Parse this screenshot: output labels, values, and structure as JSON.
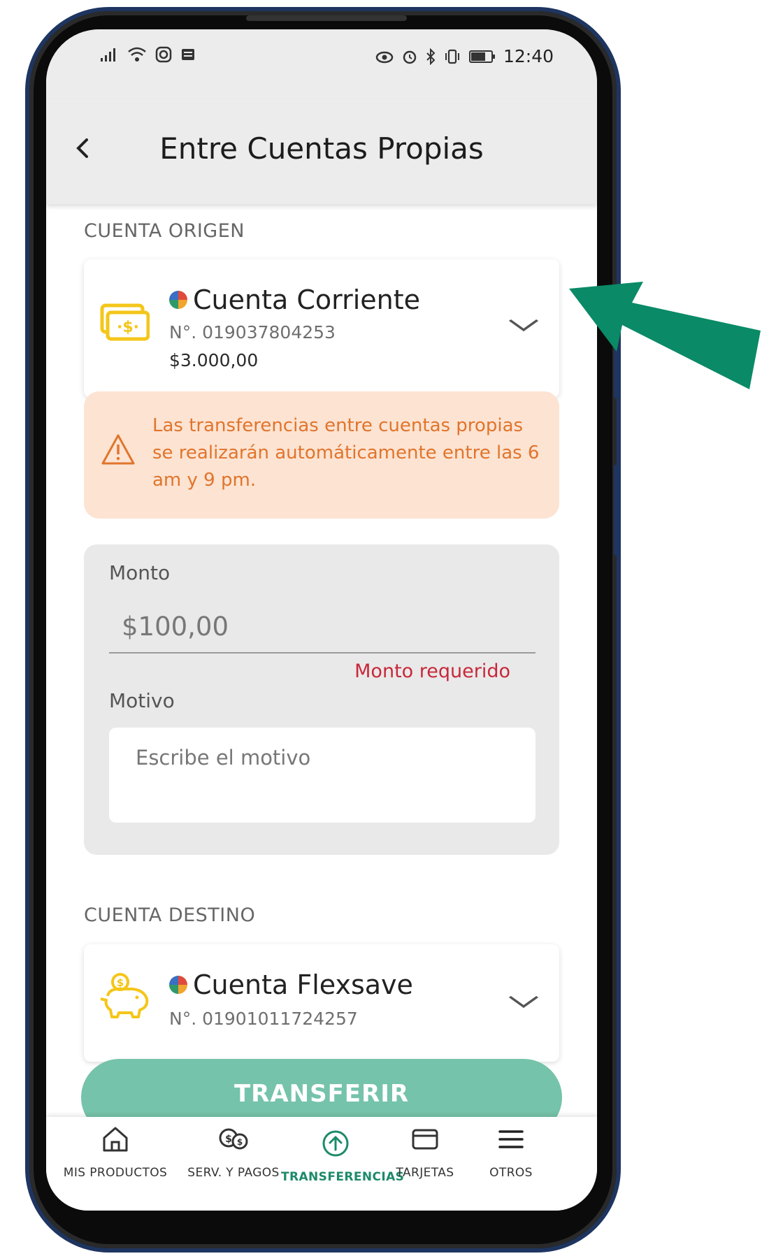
{
  "status_bar": {
    "time": "12:40"
  },
  "header": {
    "title": "Entre Cuentas Propias"
  },
  "origin": {
    "section_label": "CUENTA ORIGEN",
    "account_name": "Cuenta Corriente",
    "account_number": "N°. 019037804253",
    "balance": "$3.000,00"
  },
  "warning": {
    "text": "Las transferencias entre cuentas propias se realizarán automáticamente entre las 6 am y 9 pm."
  },
  "form": {
    "amount_label": "Monto",
    "amount_placeholder": "$100,00",
    "amount_error": "Monto requerido",
    "reason_label": "Motivo",
    "reason_placeholder": "Escribe el motivo"
  },
  "destination": {
    "section_label": "CUENTA DESTINO",
    "account_name": "Cuenta Flexsave",
    "account_number": "N°. 01901011724257"
  },
  "transfer_button": {
    "label": "TRANSFERIR"
  },
  "bottom_nav": {
    "items": [
      {
        "label": "MIS PRODUCTOS",
        "icon": "home-icon"
      },
      {
        "label": "SERV. Y PAGOS",
        "icon": "coins-icon"
      },
      {
        "label": "TRANSFERENCIAS",
        "icon": "transfer-up-icon",
        "active": true
      },
      {
        "label": "TARJETAS",
        "icon": "card-icon"
      },
      {
        "label": "OTROS",
        "icon": "menu-icon"
      }
    ]
  },
  "colors": {
    "accent": "#1d8a6a",
    "button": "#75c3aa",
    "warning_bg": "#fde3d2",
    "warning_text": "#e0752c",
    "error": "#c8283a",
    "pointer_arrow": "#0a8a66",
    "icon_yellow": "#f4c619"
  }
}
